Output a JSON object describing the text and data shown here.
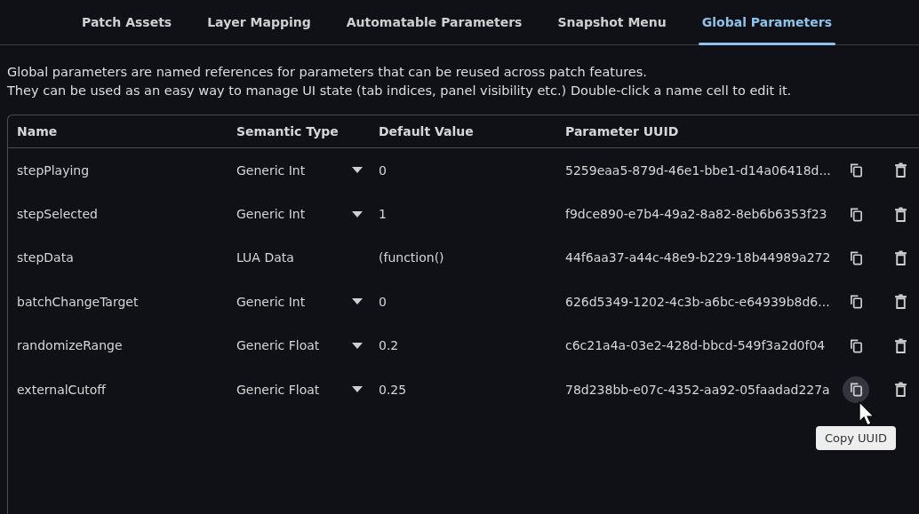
{
  "tabs": [
    {
      "label": "Patch Assets",
      "selected": false
    },
    {
      "label": "Layer Mapping",
      "selected": false
    },
    {
      "label": "Automatable Parameters",
      "selected": false
    },
    {
      "label": "Snapshot Menu",
      "selected": false
    },
    {
      "label": "Global Parameters",
      "selected": true
    }
  ],
  "description": [
    "Global parameters are named references for parameters that can be reused across patch features.",
    "They can be used as an easy way to manage UI state (tab indices, panel visibility etc.) Double-click a name cell to edit it."
  ],
  "table": {
    "columns": [
      "Name",
      "Semantic Type",
      "Default Value",
      "Parameter UUID"
    ],
    "rows": [
      {
        "name": "stepPlaying",
        "type": "Generic Int",
        "dropdown": true,
        "default": "0",
        "uuid": "5259eaa5-879d-46e1-bbe1-d14a06418d...",
        "copy_hovered": false
      },
      {
        "name": "stepSelected",
        "type": "Generic Int",
        "dropdown": true,
        "default": "1",
        "uuid": "f9dce890-e7b4-49a2-8a82-8eb6b6353f23",
        "copy_hovered": false
      },
      {
        "name": "stepData",
        "type": "LUA Data",
        "dropdown": false,
        "default": "(function()",
        "uuid": "44f6aa37-a44c-48e9-b229-18b44989a272",
        "copy_hovered": false
      },
      {
        "name": "batchChangeTarget",
        "type": "Generic Int",
        "dropdown": true,
        "default": "0",
        "uuid": "626d5349-1202-4c3b-a6bc-e64939b8d6...",
        "copy_hovered": false
      },
      {
        "name": "randomizeRange",
        "type": "Generic Float",
        "dropdown": true,
        "default": "0.2",
        "uuid": "c6c21a4a-03e2-428d-bbcd-549f3a2d0f04",
        "copy_hovered": false
      },
      {
        "name": "externalCutoff",
        "type": "Generic Float",
        "dropdown": true,
        "default": "0.25",
        "uuid": "78d238bb-e07c-4352-aa92-05faadad227a",
        "copy_hovered": true
      }
    ]
  },
  "tooltip": "Copy UUID"
}
